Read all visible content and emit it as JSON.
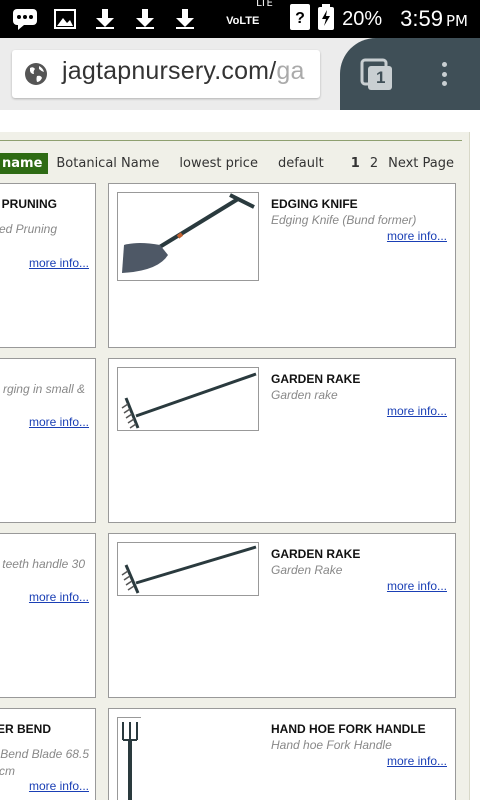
{
  "status_bar": {
    "network_label": "VoLTE",
    "lte_label": "LTE",
    "battery": "20%",
    "time": "3:59",
    "ampm": "PM"
  },
  "browser": {
    "url_main": "jagtapnursery.com/",
    "url_faded": "ga",
    "tab_count": "1"
  },
  "sort_bar": {
    "active_option": "name",
    "options": [
      "Botanical Name",
      "lowest price",
      "default"
    ],
    "pages": [
      "1",
      "2"
    ],
    "next_label": "Next Page"
  },
  "left_column": [
    {
      "title": "PRUNING",
      "subtitle": "ed Pruning",
      "more": "more info..."
    },
    {
      "title": "",
      "subtitle": "rging in small &",
      "more": "more info..."
    },
    {
      "title": "",
      "subtitle": "teeth handle 30",
      "more": "more info..."
    },
    {
      "title": "ER BEND",
      "subtitle": "Bend Blade 68.5",
      "subtitle2": "cm",
      "more": "more info..."
    }
  ],
  "products": [
    {
      "title": "EDGING KNIFE",
      "subtitle": "Edging Knife (Bund former)",
      "more": "more info...",
      "icon": "edging-knife-image"
    },
    {
      "title": "GARDEN RAKE",
      "subtitle": "Garden rake",
      "more": "more info...",
      "icon": "garden-rake-image"
    },
    {
      "title": "GARDEN RAKE",
      "subtitle": "Garden Rake",
      "more": "more info...",
      "icon": "garden-rake-image"
    },
    {
      "title": "HAND HOE FORK HANDLE",
      "subtitle": "Hand hoe Fork Handle",
      "more": "more info...",
      "icon": "hand-hoe-fork-image"
    }
  ],
  "colors": {
    "accent_green": "#2e6b14",
    "link_blue": "#1a3fb5",
    "toolbar_dark": "#3f4f57"
  }
}
